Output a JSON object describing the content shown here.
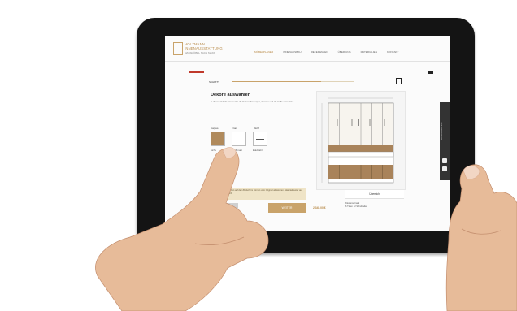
{
  "brand": {
    "name_line1": "HOLZMANN",
    "name_line2": "INNENAUSSTATTUNG",
    "tagline": "MASSMÖBEL NACH MASS"
  },
  "nav": {
    "items": [
      {
        "label": "MÖBELPLANER",
        "active": true
      },
      {
        "label": "INNENAUSBAU",
        "active": false
      },
      {
        "label": "REFERENZEN",
        "active": false
      },
      {
        "label": "ÜBER UNS",
        "active": false
      },
      {
        "label": "MATERIALIEN",
        "active": false
      },
      {
        "label": "KONTAKT",
        "active": false
      }
    ]
  },
  "configurator": {
    "step_label": "SCHRITT",
    "title": "Dekore auswählen",
    "description": "In diesem Schritt können Sie die Dekore für Korpus, Fronten und die Griffe auswählen.",
    "swatches": [
      {
        "label": "Korpus",
        "caption": "Eiche",
        "color": "#b08a5c"
      },
      {
        "label": "Front",
        "caption": "Weiß matt",
        "color": "#ffffff"
      },
      {
        "label": "Griff",
        "caption": "Edelstahl",
        "color": "#ffffff"
      }
    ],
    "note": "Hinweis: Die Farben auf dem Bildschirm können vom Original abweichen. Materialmuster auf Anfrage erhältlich.",
    "next_button": "WEITER",
    "price": "2.345,00 €"
  },
  "summary": {
    "title": "Übersicht",
    "lines": [
      "Kleiderschrank",
      "6 Türen · 2 Schubladen"
    ]
  },
  "sidebar": {
    "label": "KONFIGURATION"
  }
}
